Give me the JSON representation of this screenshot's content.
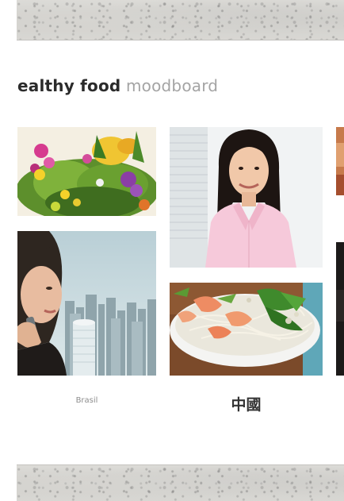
{
  "moodboard": {
    "title_bold": "ealthy food",
    "title_light": "moodboard"
  },
  "captions": {
    "brasil": "Brasil",
    "china": "中國"
  },
  "photos": [
    {
      "id": "salad",
      "subject": "colorful salad with edible flowers"
    },
    {
      "id": "woman-pink-shirt",
      "subject": "smiling woman in pink shirt"
    },
    {
      "id": "woman-phone-city",
      "subject": "woman on phone with city skyline"
    },
    {
      "id": "noodle-salad",
      "subject": "noodle salad with shrimp in bowl"
    }
  ],
  "colors": {
    "title_dark": "#2b2b2b",
    "title_light": "#a4a4a4",
    "caption": "#8d8d8d"
  }
}
